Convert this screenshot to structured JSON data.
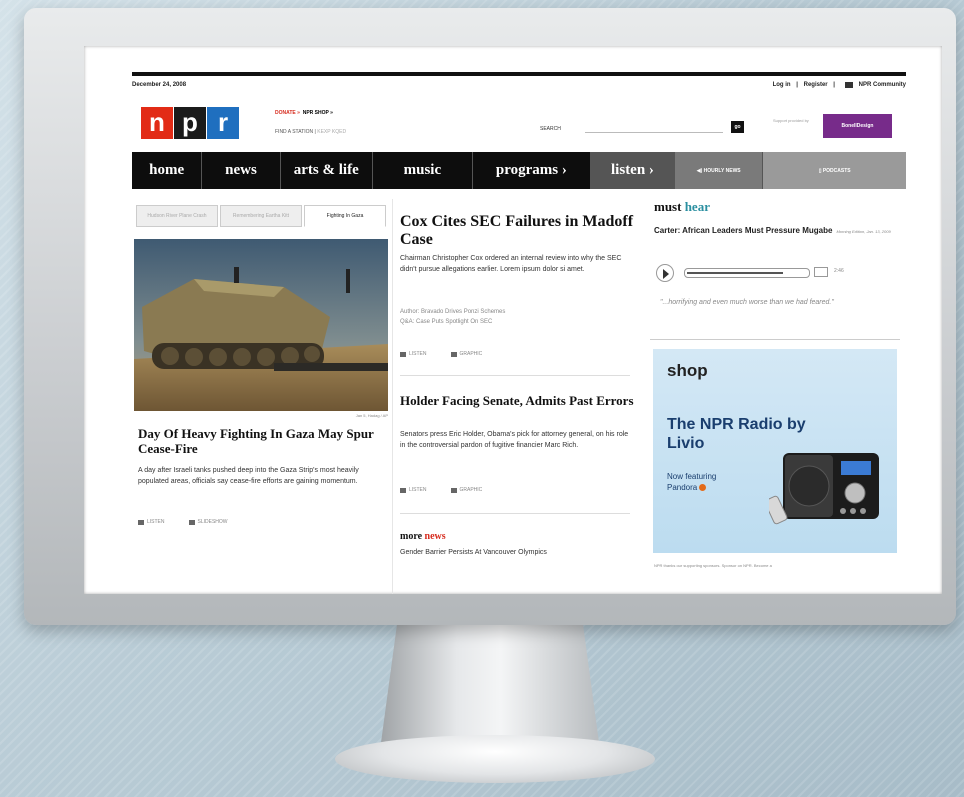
{
  "page": {
    "date": "December 24, 2008"
  },
  "toplinks": {
    "login": "Log in",
    "sep1": "|",
    "register": "Register",
    "sep2": "|",
    "community": "NPR Community"
  },
  "logo": {
    "n": "n",
    "p": "p",
    "r": "r"
  },
  "header": {
    "donate": "DONATE »",
    "shop": "NPR SHOP »",
    "find_station": "FIND A STATION",
    "sep": "|",
    "station_1": "KEXP",
    "station_2": "KQED",
    "search_label": "SEARCH",
    "search_value": "",
    "go_label": "go",
    "support_text": "Support provided by",
    "sponsor_label": "BonellDesign"
  },
  "nav": {
    "home": "home",
    "news": "news",
    "arts": "arts & life",
    "music": "music",
    "programs": "programs ›",
    "listen": "listen ›",
    "hourly": "HOURLY NEWS",
    "podcasts": "PODCASTS"
  },
  "tabs": [
    {
      "label": "Hudson River Plane Crash"
    },
    {
      "label": "Remembering Eartha Kitt"
    },
    {
      "label": "Fighting In Gaza"
    }
  ],
  "lead": {
    "credit": "Jan 5, Hadag / AP",
    "headline": "Day Of Heavy Fighting In Gaza May Spur Cease-Fire",
    "body": "A day after Israeli tanks pushed deep into the Gaza Strip's most heavily populated areas, officials say cease-fire efforts are gaining momentum.",
    "listen": "LISTEN",
    "slideshow": "SLIDESHOW"
  },
  "story1": {
    "headline": "Cox Cites SEC Failures in Madoff Case",
    "body": "Chairman Christopher Cox ordered an internal review into why the SEC didn't pursue allegations earlier. Lorem ipsum dolor si amet.",
    "related_1": "Author: Bravado Drives Ponzi Schemes",
    "related_2": "Q&A: Case Puts Spotlight On SEC",
    "listen": "LISTEN",
    "graphic": "GRAPHIC"
  },
  "story2": {
    "headline": "Holder Facing Senate, Admits Past Errors",
    "body": "Senators press Eric Holder, Obama's pick for attorney general, on his role in the controversial pardon of fugitive financier Marc Rich.",
    "listen": "LISTEN",
    "graphic": "GRAPHIC"
  },
  "more_news": {
    "label_a": "more ",
    "label_b": "news",
    "item_1": "Gender Barrier Persists At Vancouver Olympics"
  },
  "must_hear": {
    "label_a": "must ",
    "label_b": "hear",
    "story": "Carter: African Leaders Must Pressure Mugabe",
    "meta": "Morning Edition, Jan. 13, 2009",
    "time": "2:46",
    "quote": "\"...horrifying and even much worse than we had feared.\"",
    "progress": 0.8
  },
  "shop": {
    "heading": "shop",
    "title": "The NPR Radio by Livio",
    "sub_1": "Now featuring",
    "sub_2": "Pandora",
    "fine": "NPR thanks our supporting sponsors. Sponsor on NPR. Become a"
  },
  "colors": {
    "npr_red": "#e22b16",
    "npr_black": "#1b1b1b",
    "npr_blue": "#1f6fbf",
    "sponsor_purple": "#772b8a",
    "teal": "#2a8fa0"
  }
}
